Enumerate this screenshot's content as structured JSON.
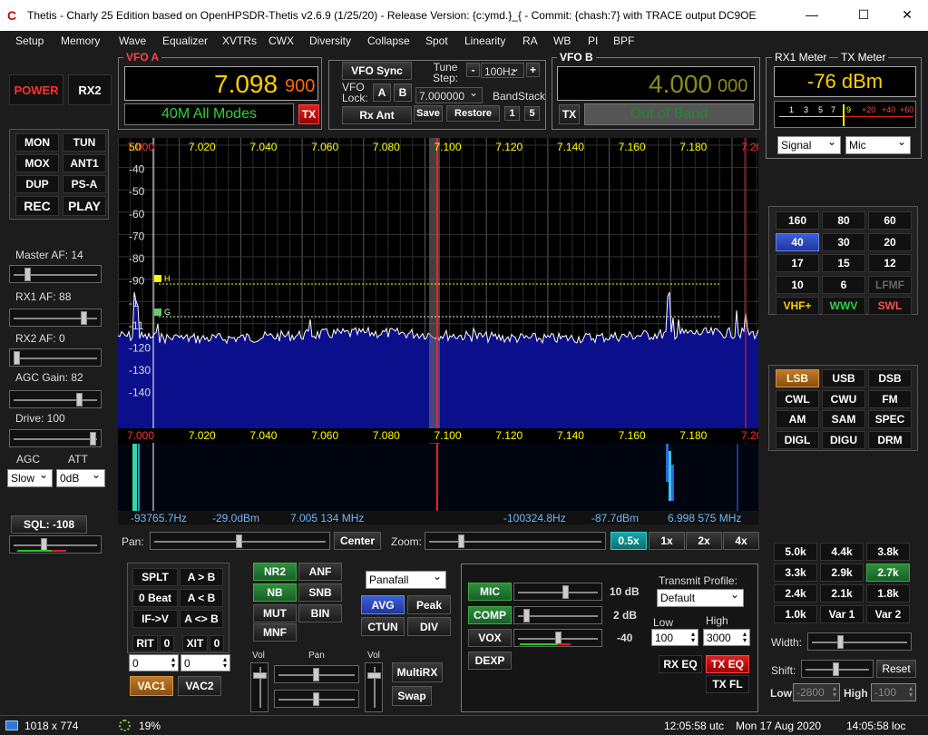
{
  "title": "Thetis - Charly 25 Edition based on OpenHPSDR-Thetis v2.6.9 (1/25/20) - Release Version: {c:ymd.}_{ - Commit: {chash:7} with TRACE output    DC9OE",
  "menu": [
    "Setup",
    "Memory",
    "Wave",
    "Equalizer",
    "XVTRs",
    "CWX",
    "Diversity",
    "Collapse",
    "Spot",
    "Linearity",
    "RA",
    "WB",
    "PI",
    "BPF"
  ],
  "vfoa": {
    "title": "VFO A",
    "freq_main": "7.098",
    "freq_sub": "900",
    "band": "40M All Modes",
    "tx": "TX"
  },
  "vfosync": {
    "sync": "VFO Sync",
    "lock": "VFO\nLock:",
    "a": "A",
    "b": "B",
    "rxant": "Rx Ant",
    "tune_step": "Tune\nStep:",
    "step_value": "100Hz",
    "minus": "-",
    "plus": "+",
    "freq_entry": "7.000000",
    "bandstack": "BandStack",
    "save": "Save",
    "restore": "Restore",
    "bs1": "1",
    "bs5": "5"
  },
  "vfob": {
    "title": "VFO B",
    "freq_main": "4.000",
    "freq_sub": "000",
    "band": "Out of Band",
    "tx": "TX"
  },
  "meter": {
    "rx_title": "RX1 Meter",
    "tx_title": "TX Meter",
    "value": "-76 dBm",
    "scale": [
      "1",
      "3",
      "5",
      "7",
      "9",
      "+20",
      "+40",
      "+60"
    ],
    "rx_mode": "Signal",
    "tx_mode": "Mic"
  },
  "leftbtns": {
    "power": "POWER",
    "rx2": "RX2",
    "mon": "MON",
    "tun": "TUN",
    "mox": "MOX",
    "ant1": "ANT1",
    "dup": "DUP",
    "psa": "PS-A",
    "rec": "REC",
    "play": "PLAY"
  },
  "levels": {
    "master_af": "Master AF:  14",
    "rx1_af": "RX1 AF:  88",
    "rx2_af": "RX2 AF:  0",
    "agc_gain": "AGC Gain:  82",
    "drive": "Drive:  100",
    "agc": "AGC",
    "att": "ATT",
    "agc_value": "Slow",
    "att_value": "0dB",
    "sql": "SQL:  -108"
  },
  "levels_frac": {
    "master_af": 0.14,
    "rx1_af": 0.88,
    "rx2_af": 0.0,
    "agc_gain": 0.82,
    "drive": 1.0
  },
  "spectrum": {
    "freq_labels": [
      "7.000",
      "7.020",
      "7.040",
      "7.060",
      "7.080",
      "7.100",
      "7.120",
      "7.140",
      "7.160",
      "7.180",
      "7.20"
    ],
    "db_labels": [
      "50",
      "-40",
      "-50",
      "-60",
      "-70",
      "-80",
      "-90",
      "-1",
      "-11",
      "-120",
      "-130",
      "-140"
    ],
    "marker_h": "H",
    "marker_g": "G"
  },
  "spectrum_colors": {
    "fill": "#0b0f8c",
    "grid": "#5a5a5a",
    "cursor": "#ff2020",
    "label": "#ffff00",
    "vfo_band": "#777777"
  },
  "infobar": {
    "left1": "-93765.7Hz",
    "left2": "-29.0dBm",
    "left3": "7.005 134 MHz",
    "right1": "-100324.8Hz",
    "right2": "-87.7dBm",
    "right3": "6.998 575 MHz"
  },
  "pan": {
    "pan": "Pan:",
    "center": "Center",
    "zoom": "Zoom:",
    "z05": "0.5x",
    "z1": "1x",
    "z2": "2x",
    "z4": "4x"
  },
  "bands": [
    "160",
    "80",
    "60",
    "40",
    "30",
    "20",
    "17",
    "15",
    "12",
    "10",
    "6",
    "LFMF",
    "VHF+",
    "WWV",
    "SWL"
  ],
  "modes": [
    "LSB",
    "USB",
    "DSB",
    "CWL",
    "CWU",
    "FM",
    "AM",
    "SAM",
    "SPEC",
    "DIGL",
    "DIGU",
    "DRM"
  ],
  "filters": [
    "5.0k",
    "4.4k",
    "3.8k",
    "3.3k",
    "2.9k",
    "2.7k",
    "2.4k",
    "2.1k",
    "1.8k",
    "1.0k",
    "Var 1",
    "Var 2"
  ],
  "filtercontrols": {
    "width": "Width:",
    "shift": "Shift:",
    "reset": "Reset",
    "low": "Low",
    "low_value": "-2800",
    "high": "High",
    "high_value": "-100"
  },
  "rxcontrols": {
    "splt": "SPLT",
    "ab": "A > B",
    "zerobeat": "0 Beat",
    "ba": "A < B",
    "ifv": "IF->V",
    "aswap": "A <> B",
    "rit": "RIT",
    "rit_value": "0",
    "xit": "XIT",
    "xit_value": "0",
    "rit_num": "0",
    "xit_num": "0",
    "vac1": "VAC1",
    "vac2": "VAC2"
  },
  "dsp": {
    "nr2": "NR2",
    "anf": "ANF",
    "nb": "NB",
    "snb": "SNB",
    "mut": "MUT",
    "bin": "BIN",
    "mnf": "MNF",
    "display": "Panafall",
    "avg": "AVG",
    "peak": "Peak",
    "ctun": "CTUN",
    "div": "DIV"
  },
  "mixer": {
    "vol": "Vol",
    "pan": "Pan",
    "vol2": "Vol",
    "multirx": "MultiRX",
    "swap": "Swap"
  },
  "tx": {
    "mic": "MIC",
    "mic_val": "10 dB",
    "comp": "COMP",
    "comp_val": "2 dB",
    "vox": "VOX",
    "vox_val": "-40",
    "dexp": "DEXP",
    "profile_title": "Transmit Profile:",
    "profile": "Default",
    "low": "Low",
    "high": "High",
    "low_value": "100",
    "high_value": "3000",
    "rxeq": "RX EQ",
    "txeq": "TX EQ",
    "txfl": "TX FL"
  },
  "status": {
    "size": "1018 x 774",
    "cpu": "19%",
    "utc": "12:05:58 utc",
    "date": "Mon 17 Aug 2020",
    "loc": "14:05:58 loc"
  }
}
